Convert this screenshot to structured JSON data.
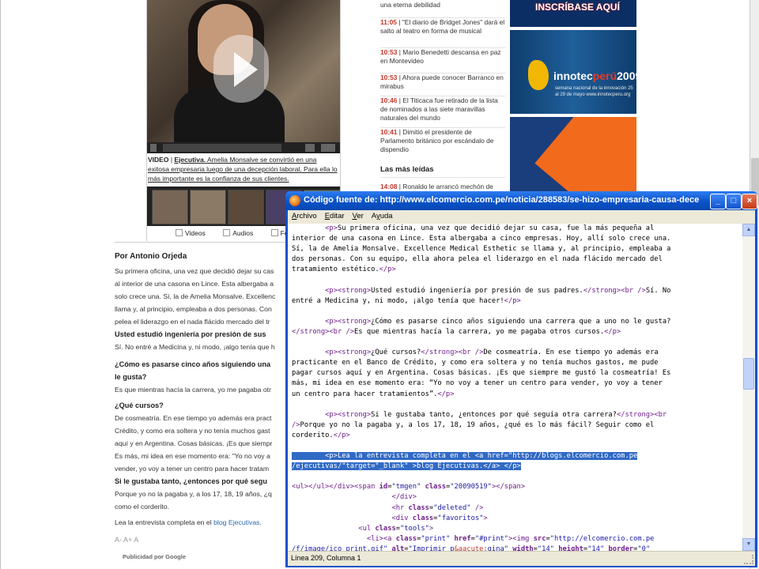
{
  "background_page": {
    "video": {
      "caption_prefix": "VIDEO",
      "caption_title": "Ejecutiva.",
      "caption_text": " Amelia Monsalve se convirtió en una exitosa empresaria luego de una decepción laboral. Para ella lo más importante es la confianza de sus clientes.",
      "tabs": [
        "Videos",
        "Audios",
        "Fotos"
      ]
    },
    "author": "Por Antonio Orjeda",
    "article_lines": [
      {
        "text": "Su primera oficina, una vez que decidió dejar su cas",
        "bold": false
      },
      {
        "text": "al interior de una casona en Lince. Esta albergaba a",
        "bold": false
      },
      {
        "text": "solo crece una. Sí, la de Amelia Monsalve. Excellenc",
        "bold": false
      },
      {
        "text": "llama y, al principio, empleaba a dos personas. Con",
        "bold": false
      },
      {
        "text": "pelea el liderazgo en el nada flácido mercado del tr",
        "bold": false
      },
      {
        "text": "Usted estudió ingeniería por presión de sus",
        "bold": true
      },
      {
        "text": "Sí. No entré a Medicina y, ni modo, ¡algo tenía que h",
        "bold": false
      },
      {
        "text": "¿Cómo es pasarse cinco años siguiendo una",
        "bold": true
      },
      {
        "text": "le gusta?",
        "bold": true
      },
      {
        "text": "Es que mientras hacía la carrera, yo me pagaba otr",
        "bold": false
      },
      {
        "text": "¿Qué cursos?",
        "bold": true
      },
      {
        "text": "De cosmeatría. En ese tiempo yo además era pract",
        "bold": false
      },
      {
        "text": "Crédito, y como era soltera y no tenía muchos gast",
        "bold": false
      },
      {
        "text": "aquí y en Argentina. Cosas básicas. ¡Es que siempr",
        "bold": false
      },
      {
        "text": "Es más, mi idea en ese momento era: \"Yo no voy a",
        "bold": false
      },
      {
        "text": "vender, yo voy a tener un centro para hacer tratam",
        "bold": false
      },
      {
        "text": "Si le gustaba tanto, ¿entonces por qué segu",
        "bold": true
      },
      {
        "text": "Porque yo no la pagaba y, a los 17, 18, 19 años, ¿q",
        "bold": false
      },
      {
        "text": "como el corderito.",
        "bold": false
      }
    ],
    "read_more_prefix": "Lea la entrevista completa en el ",
    "read_more_link": "blog Ejecutivas",
    "read_more_suffix": ".",
    "font_tools": "A-  A+  A",
    "published_by": "Publicidad por Google",
    "news": [
      {
        "time": "",
        "text": "una eterna debilidad"
      },
      {
        "time": "11:05",
        "text": "\"El diario de Bridget Jones\" dará el salto al teatro en forma de musical"
      },
      {
        "time": "10:53",
        "text": "Mario Benedetti descansa en paz en Montevideo"
      },
      {
        "time": "10:53",
        "text": "Ahora puede conocer Barranco en mirabus"
      },
      {
        "time": "10:46",
        "text": "El Titicaca fue retirado de la lista de nominados a las siete maravillas naturales del mundo"
      },
      {
        "time": "10:41",
        "text": "Dimitió el presidente de Parlamento británico por escándalo de dispendio"
      }
    ],
    "most_read_title": "Las más leídas",
    "most_read": [
      {
        "time": "14:08",
        "text": "Ronaldo le arrancó mechón de"
      }
    ],
    "ads": {
      "ad1_text": "INSCRÍBASE AQUÍ",
      "ad2_brand": "innotec",
      "ad2_brand_red": "perú",
      "ad2_year": "2009",
      "ad2_sub": "semana nacional de la innovación 25 al 29 de mayo www.innotecperu.org"
    }
  },
  "source_window": {
    "title": "Código fuente de: http://www.elcomercio.com.pe/noticia/288583/se-hizo-empresaria-causa-decepcion-lab...",
    "menu": [
      {
        "label": "Archivo",
        "key": "A"
      },
      {
        "label": "Editar",
        "key": "E"
      },
      {
        "label": "Ver",
        "key": "V"
      },
      {
        "label": "Ayuda",
        "key": "y"
      }
    ],
    "status": "Línea 209, Columna 1",
    "buttons": {
      "minimize": "_",
      "maximize": "□",
      "close": "×"
    }
  }
}
